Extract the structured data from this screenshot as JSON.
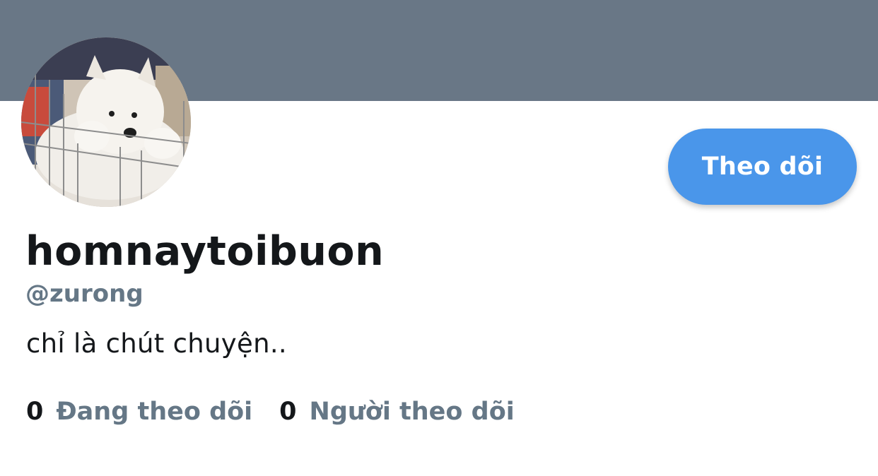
{
  "profile": {
    "display_name": "homnaytoibuon",
    "handle": "@zurong",
    "bio": "chỉ là chút chuyện..",
    "avatar_icon": "samoyed-puppy-photo"
  },
  "actions": {
    "follow_label": "Theo dõi"
  },
  "stats": {
    "following": {
      "count": "0",
      "label": "Đang theo dõi"
    },
    "followers": {
      "count": "0",
      "label": "Người theo dõi"
    }
  },
  "colors": {
    "banner": "#697786",
    "accent": "#4a96ea",
    "text_primary": "#14171a",
    "text_secondary": "#657786"
  }
}
